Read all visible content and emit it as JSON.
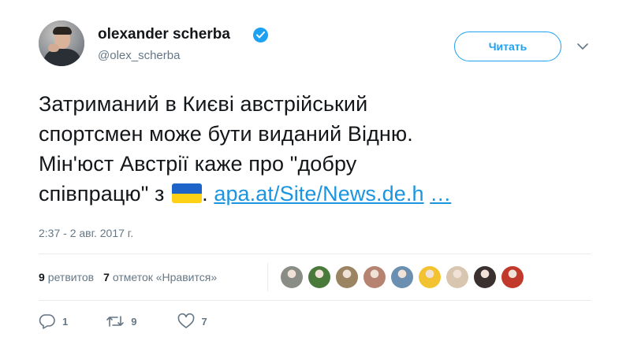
{
  "author": {
    "name": "olexander scherba",
    "handle": "@olex_scherba",
    "verified_icon": "verified-badge-icon"
  },
  "header": {
    "follow_label": "Читать",
    "more_icon": "chevron-down-icon"
  },
  "tweet": {
    "line1": "Затриманий в Києві австрійський",
    "line2": "спортсмен може бути виданий Відню.",
    "line3": "Мін'юст Австрії каже про \"добру",
    "line4_prefix": "співпрацю\" з",
    "flag_icon": "ukraine-flag-icon",
    "line4_after_flag": ".",
    "link_text": "apa.at/Site/News.de.h",
    "ellipsis": "…"
  },
  "timestamp": "2:37 - 2 авг. 2017 г.",
  "stats": {
    "retweets_count": "9",
    "retweets_label": "ретвитов",
    "likes_count": "7",
    "likes_label": "отметок «Нравится»"
  },
  "likers": [
    {
      "name": "liker-avatar-1",
      "color": "#8a8d85"
    },
    {
      "name": "liker-avatar-2",
      "color": "#4a7a3b"
    },
    {
      "name": "liker-avatar-3",
      "color": "#9a8462"
    },
    {
      "name": "liker-avatar-4",
      "color": "#b5836f"
    },
    {
      "name": "liker-avatar-5",
      "color": "#6b8fb0"
    },
    {
      "name": "liker-avatar-6",
      "color": "#f2c230"
    },
    {
      "name": "liker-avatar-7",
      "color": "#d8c6b0"
    },
    {
      "name": "liker-avatar-8",
      "color": "#3a3030"
    },
    {
      "name": "liker-avatar-9",
      "color": "#c0392b"
    }
  ],
  "actions": {
    "reply_count": "1",
    "retweet_count": "9",
    "like_count": "7"
  },
  "colors": {
    "accent": "#1da1f2",
    "link": "#1b95e0",
    "secondary_text": "#657786"
  }
}
